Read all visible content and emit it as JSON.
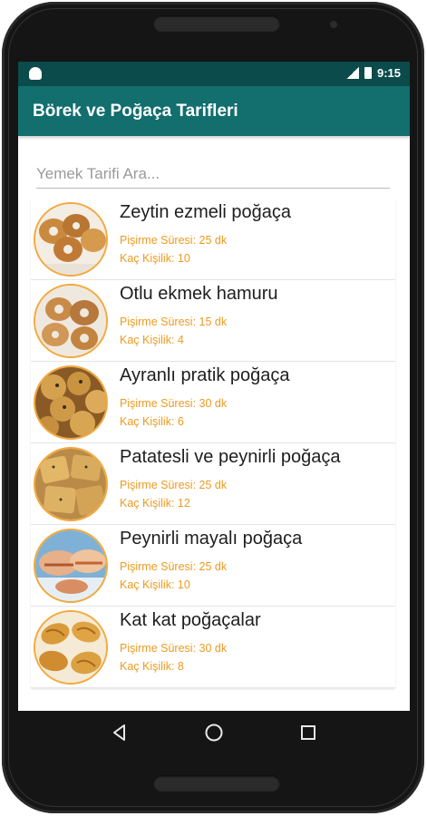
{
  "status_bar": {
    "time": "9:15"
  },
  "app_bar": {
    "title": "Börek ve Poğaça Tarifleri"
  },
  "search": {
    "placeholder": "Yemek Tarifi Ara..."
  },
  "recipes": [
    {
      "title": "Zeytin ezmeli poğaça",
      "cook_time": "Pişirme Süresi: 25 dk",
      "servings": "Kaç Kişilik: 10"
    },
    {
      "title": "Otlu ekmek hamuru",
      "cook_time": "Pişirme Süresi: 15 dk",
      "servings": "Kaç Kişilik: 4"
    },
    {
      "title": "Ayranlı pratik poğaça",
      "cook_time": "Pişirme Süresi: 30 dk",
      "servings": "Kaç Kişilik: 6"
    },
    {
      "title": "Patatesli ve peynirli poğaça",
      "cook_time": "Pişirme Süresi: 25 dk",
      "servings": "Kaç Kişilik: 12"
    },
    {
      "title": "Peynirli mayalı poğaça",
      "cook_time": "Pişirme Süresi: 25 dk",
      "servings": "Kaç Kişilik: 10"
    },
    {
      "title": "Kat kat poğaçalar",
      "cook_time": "Pişirme Süresi: 30 dk",
      "servings": "Kaç Kişilik: 8"
    }
  ],
  "colors": {
    "status_bar": "#0b4b4b",
    "app_bar": "#136e6e",
    "meta_text": "#ee9a1f",
    "thumb_border": "#f3a93c"
  },
  "icons": {
    "nav_back": "back-triangle-icon",
    "nav_home": "home-circle-icon",
    "nav_recents": "recents-square-icon"
  }
}
